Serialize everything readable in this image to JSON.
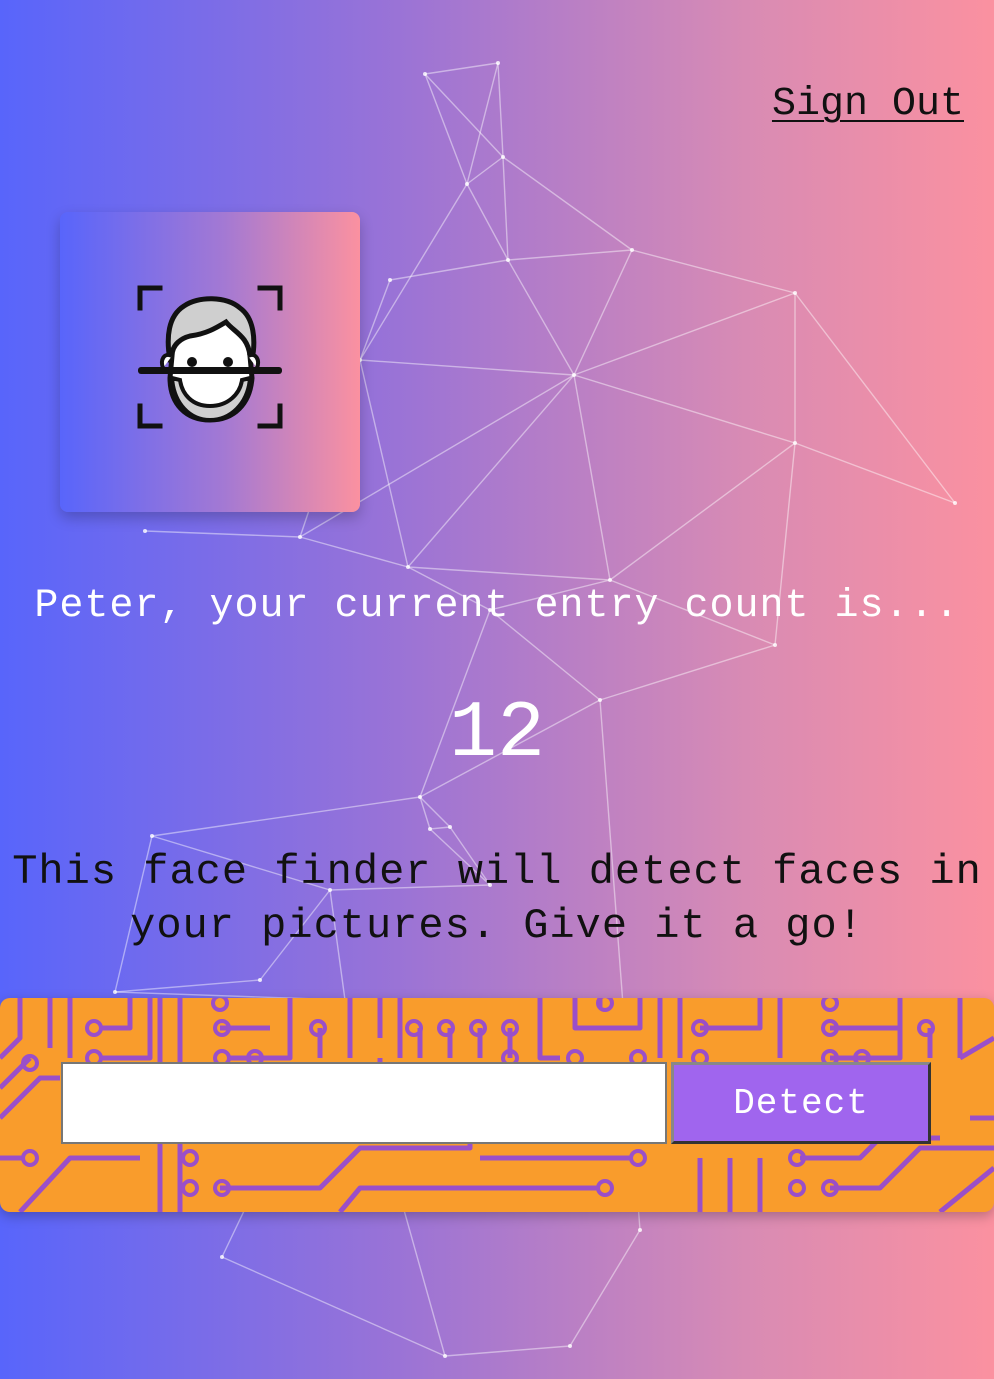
{
  "nav": {
    "sign_out_label": "Sign Out"
  },
  "logo": {
    "icon": "face-scan-icon"
  },
  "rank": {
    "message": "Peter, your current entry count is...",
    "entry_count": "12"
  },
  "intro": {
    "text": "This face finder will detect faces in your pictures. Give it a go!"
  },
  "image_form": {
    "url_input_value": "",
    "url_input_placeholder": "",
    "detect_button_label": "Detect"
  },
  "colors": {
    "gradient_start": "#5865fb",
    "gradient_end": "#fb91a0",
    "form_background": "#f99c2c",
    "circuit_lines": "#9a4fc9",
    "detect_button": "#a065ee"
  }
}
